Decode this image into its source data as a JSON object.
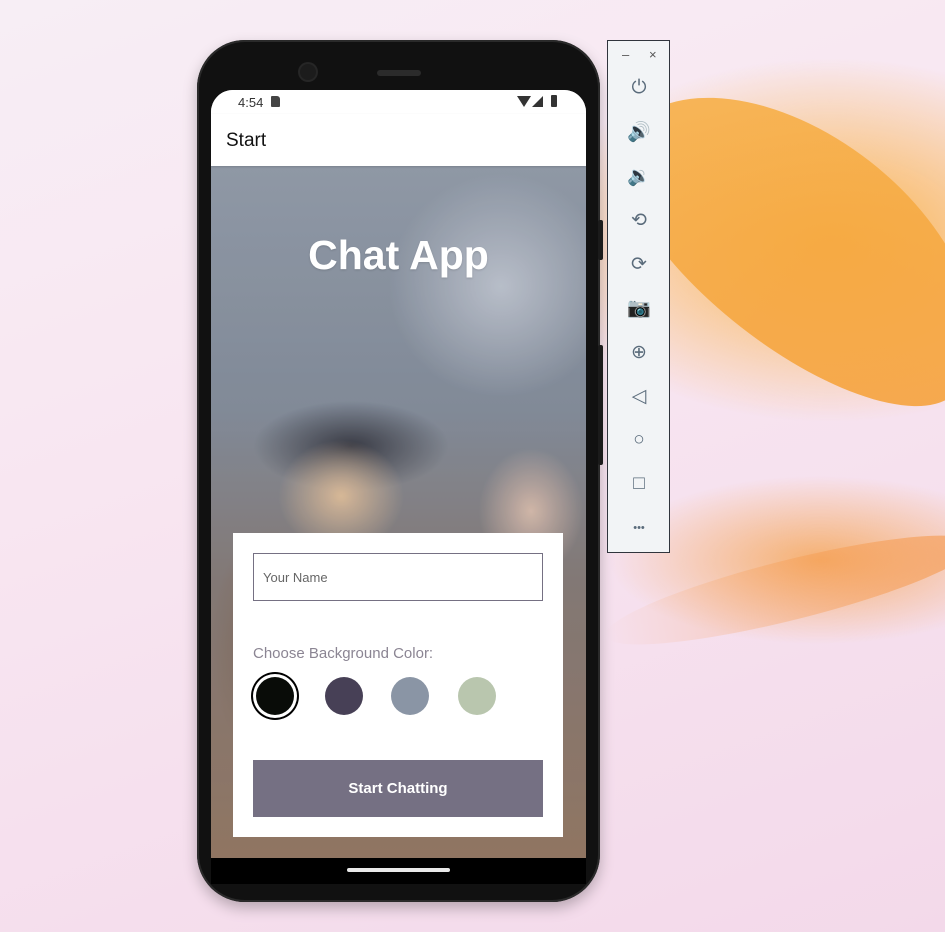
{
  "phone": {
    "status_bar": {
      "time": "4:54"
    },
    "app_bar": {
      "title": "Start"
    },
    "start_screen": {
      "title": "Chat App",
      "name_input": {
        "value": "",
        "placeholder": "Your Name"
      },
      "choose_color_label": "Choose Background Color:",
      "color_options": [
        {
          "name": "black",
          "color": "#090C08",
          "selected": true
        },
        {
          "name": "dark-purple",
          "color": "#474056",
          "selected": false
        },
        {
          "name": "grey-blue",
          "color": "#8A95A5",
          "selected": false
        },
        {
          "name": "sage-green",
          "color": "#B9C6AE",
          "selected": false
        }
      ],
      "start_button_label": "Start Chatting",
      "button_color": "#757083"
    }
  },
  "emulator_toolbar": {
    "minimize_glyph": "–",
    "close_glyph": "×",
    "tools": [
      {
        "icon": "power-icon",
        "glyph": "⏻"
      },
      {
        "icon": "volume-up-icon",
        "glyph": "🔊"
      },
      {
        "icon": "volume-down-icon",
        "glyph": "🔉"
      },
      {
        "icon": "rotate-left-icon",
        "glyph": "⟲"
      },
      {
        "icon": "rotate-right-icon",
        "glyph": "⟳"
      },
      {
        "icon": "camera-icon",
        "glyph": "📷"
      },
      {
        "icon": "zoom-icon",
        "glyph": "⊕"
      },
      {
        "icon": "back-icon",
        "glyph": "◁"
      },
      {
        "icon": "home-icon",
        "glyph": "○"
      },
      {
        "icon": "overview-icon",
        "glyph": "□"
      },
      {
        "icon": "more-icon",
        "glyph": "•••"
      }
    ]
  }
}
